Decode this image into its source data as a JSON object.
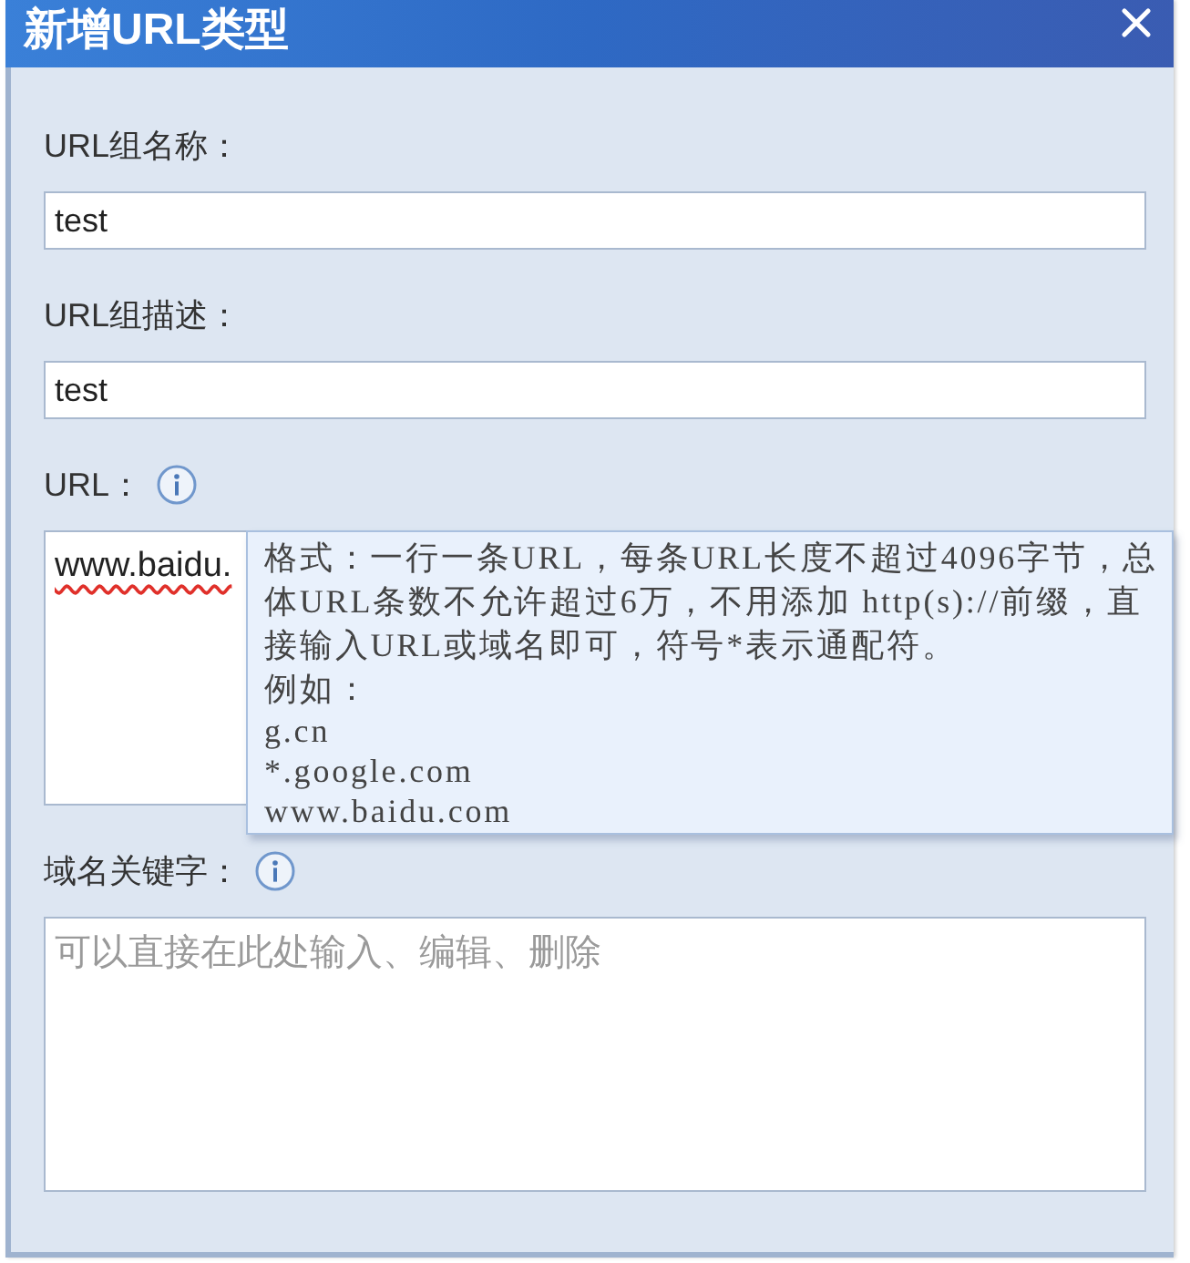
{
  "window": {
    "title": "新增URL类型"
  },
  "fields": [
    {
      "kind": "input",
      "label": "URL组名称：",
      "value": "test"
    },
    {
      "kind": "input",
      "label": "URL组描述：",
      "value": "test"
    },
    {
      "kind": "textarea",
      "label": "URL：",
      "info": true,
      "value": "www.baidu.",
      "misspelled": true,
      "tooltip": {
        "text": "格式：一行一条URL，每条URL长度不超过4096字节，总体URL条数不允许超过6万，不用添加 http(s)://前缀，直接输入URL或域名即可，符号*表示通配符。",
        "example_heading": "例如：",
        "examples": [
          "g.cn",
          "*.google.com",
          "www.baidu.com"
        ]
      }
    },
    {
      "kind": "textarea",
      "label": "域名关键字：",
      "info": true,
      "placeholder": "可以直接在此处输入、编辑、删除"
    }
  ]
}
